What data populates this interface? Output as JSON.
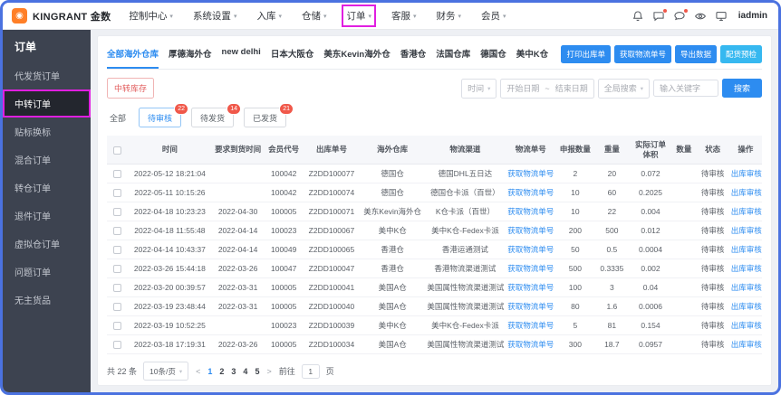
{
  "colors": {
    "accent": "#2d8cf0",
    "badge": "#f0584a",
    "annotation": "#e01fe0",
    "window_border": "#4b72e0",
    "sidebar_bg": "#3d4350",
    "sidebar_active": "#23262e",
    "brand_orange": "#ff7f27"
  },
  "glyphs": {
    "caret": "▾"
  },
  "brand": {
    "logo_glyph": "◉",
    "name": "KINGRANT 金数"
  },
  "topnav": {
    "items": [
      {
        "name": "control-center",
        "label": "控制中心",
        "annotated": false
      },
      {
        "name": "system-settings",
        "label": "系统设置",
        "annotated": false
      },
      {
        "name": "inbound",
        "label": "入库",
        "annotated": false
      },
      {
        "name": "storage",
        "label": "仓储",
        "annotated": false
      },
      {
        "name": "orders",
        "label": "订单",
        "annotated": true
      },
      {
        "name": "customer-service",
        "label": "客服",
        "annotated": false
      },
      {
        "name": "finance",
        "label": "财务",
        "annotated": false
      },
      {
        "name": "members",
        "label": "会员",
        "annotated": false
      }
    ],
    "username": "iadmin"
  },
  "sidebar": {
    "title": "订单",
    "items": [
      {
        "name": "dropship-orders",
        "label": "代发货订单",
        "active": false,
        "annotated": false
      },
      {
        "name": "transit-orders",
        "label": "中转订单",
        "active": true,
        "annotated": true
      },
      {
        "name": "relabel",
        "label": "贴标换标",
        "active": false,
        "annotated": false
      },
      {
        "name": "mixed-orders",
        "label": "混合订单",
        "active": false,
        "annotated": false
      },
      {
        "name": "transfer-orders",
        "label": "转仓订单",
        "active": false,
        "annotated": false
      },
      {
        "name": "return-orders",
        "label": "退件订单",
        "active": false,
        "annotated": false
      },
      {
        "name": "virtual-warehouse-orders",
        "label": "虚拟仓订单",
        "active": false,
        "annotated": false
      },
      {
        "name": "problem-orders",
        "label": "问题订单",
        "active": false,
        "annotated": false
      },
      {
        "name": "unowned-goods",
        "label": "无主货品",
        "active": false,
        "annotated": false
      }
    ]
  },
  "warehouse_tabs": [
    {
      "name": "all-warehouses",
      "label": "全部海外仓库",
      "active": true
    },
    {
      "name": "houde",
      "label": "厚德海外仓",
      "active": false
    },
    {
      "name": "new-delhi",
      "label": "new delhi",
      "active": false
    },
    {
      "name": "osaka",
      "label": "日本大阪仓",
      "active": false
    },
    {
      "name": "kevin-us-east",
      "label": "美东Kevin海外仓",
      "active": false
    },
    {
      "name": "hongkong",
      "label": "香港仓",
      "active": false
    },
    {
      "name": "france",
      "label": "法国仓库",
      "active": false
    },
    {
      "name": "germany",
      "label": "德国仓",
      "active": false
    },
    {
      "name": "us-k",
      "label": "美中K仓",
      "active": false
    }
  ],
  "action_buttons": [
    {
      "name": "print-outbound",
      "label": "打印出库单",
      "color": "#2d8cf0"
    },
    {
      "name": "get-tracking",
      "label": "获取物流单号",
      "color": "#2d8cf0"
    },
    {
      "name": "export-data",
      "label": "导出数据",
      "color": "#2d8cf0"
    },
    {
      "name": "picking-precheck",
      "label": "配货预检",
      "color": "#36b8f0"
    }
  ],
  "toolbar": {
    "stock_button": "中转库存",
    "time_select": "时间",
    "date_start": "开始日期",
    "date_separator": "~",
    "date_end": "结束日期",
    "search_select": "全局搜索",
    "keyword_placeholder": "输入关键字",
    "search_button": "搜索"
  },
  "status_filters": [
    {
      "name": "all",
      "label": "全部",
      "badge": null,
      "active": false,
      "plain": true
    },
    {
      "name": "pending-review",
      "label": "待审核",
      "badge": "22",
      "active": true,
      "plain": false
    },
    {
      "name": "pending-ship",
      "label": "待发货",
      "badge": "14",
      "active": false,
      "plain": false
    },
    {
      "name": "shipped",
      "label": "已发货",
      "badge": "21",
      "active": false,
      "plain": false
    }
  ],
  "table": {
    "columns": [
      "",
      "时间",
      "要求到货时间",
      "会员代号",
      "出库单号",
      "海外仓库",
      "物流渠道",
      "物流单号",
      "申报数量",
      "重量",
      "实际订单体积",
      "数量",
      "状态",
      "操作"
    ],
    "logistics_link": "获取物流单号",
    "action_link": "出库审核",
    "rows": [
      {
        "time": "2022-05-12 18:21:04",
        "required": "",
        "member": "100042",
        "order_no": "Z2DD100077",
        "warehouse": "德国仓",
        "channel": "德国DHL五日达",
        "qty": "2",
        "weight": "20",
        "volume": "0.072",
        "count": "",
        "status": "待审核"
      },
      {
        "time": "2022-05-11 10:15:26",
        "required": "",
        "member": "100042",
        "order_no": "Z2DD100074",
        "warehouse": "德国仓",
        "channel": "德国仓卡派（百世）",
        "qty": "10",
        "weight": "60",
        "volume": "0.2025",
        "count": "",
        "status": "待审核"
      },
      {
        "time": "2022-04-18 10:23:23",
        "required": "2022-04-30",
        "member": "100005",
        "order_no": "Z2DD100071",
        "warehouse": "美东Kevin海外仓",
        "channel": "K仓卡派（百世）",
        "qty": "10",
        "weight": "22",
        "volume": "0.004",
        "count": "",
        "status": "待审核"
      },
      {
        "time": "2022-04-18 11:55:48",
        "required": "2022-04-14",
        "member": "100023",
        "order_no": "Z2DD100067",
        "warehouse": "美中K仓",
        "channel": "美中K仓-Fedex卡派",
        "qty": "200",
        "weight": "500",
        "volume": "0.012",
        "count": "",
        "status": "待审核"
      },
      {
        "time": "2022-04-14 10:43:37",
        "required": "2022-04-14",
        "member": "100049",
        "order_no": "Z2DD100065",
        "warehouse": "香港仓",
        "channel": "香港运通测试",
        "qty": "50",
        "weight": "0.5",
        "volume": "0.0004",
        "count": "",
        "status": "待审核"
      },
      {
        "time": "2022-03-26 15:44:18",
        "required": "2022-03-26",
        "member": "100047",
        "order_no": "Z2DD100047",
        "warehouse": "香港仓",
        "channel": "香港物流渠道测试",
        "qty": "500",
        "weight": "0.3335",
        "volume": "0.002",
        "count": "",
        "status": "待审核"
      },
      {
        "time": "2022-03-20 00:39:57",
        "required": "2022-03-31",
        "member": "100005",
        "order_no": "Z2DD100041",
        "warehouse": "美国A仓",
        "channel": "美国属性物流渠道测试",
        "qty": "100",
        "weight": "3",
        "volume": "0.04",
        "count": "",
        "status": "待审核"
      },
      {
        "time": "2022-03-19 23:48:44",
        "required": "2022-03-31",
        "member": "100005",
        "order_no": "Z2DD100040",
        "warehouse": "美国A仓",
        "channel": "美国属性物流渠道测试",
        "qty": "80",
        "weight": "1.6",
        "volume": "0.0006",
        "count": "",
        "status": "待审核"
      },
      {
        "time": "2022-03-19 10:52:25",
        "required": "",
        "member": "100023",
        "order_no": "Z2DD100039",
        "warehouse": "美中K仓",
        "channel": "美中K仓-Fedex卡派",
        "qty": "5",
        "weight": "81",
        "volume": "0.154",
        "count": "",
        "status": "待审核"
      },
      {
        "time": "2022-03-18 17:19:31",
        "required": "2022-03-26",
        "member": "100005",
        "order_no": "Z2DD100034",
        "warehouse": "美国A仓",
        "channel": "美国属性物流渠道测试",
        "qty": "300",
        "weight": "18.7",
        "volume": "0.0957",
        "count": "",
        "status": "待审核"
      }
    ]
  },
  "pagination": {
    "total": "共 22 条",
    "page_size": "10条/页",
    "prev": "<",
    "next": ">",
    "pages": [
      "1",
      "2",
      "3",
      "4",
      "5"
    ],
    "current": "1",
    "goto_label": "前往",
    "goto_value": "1",
    "goto_suffix": "页"
  }
}
